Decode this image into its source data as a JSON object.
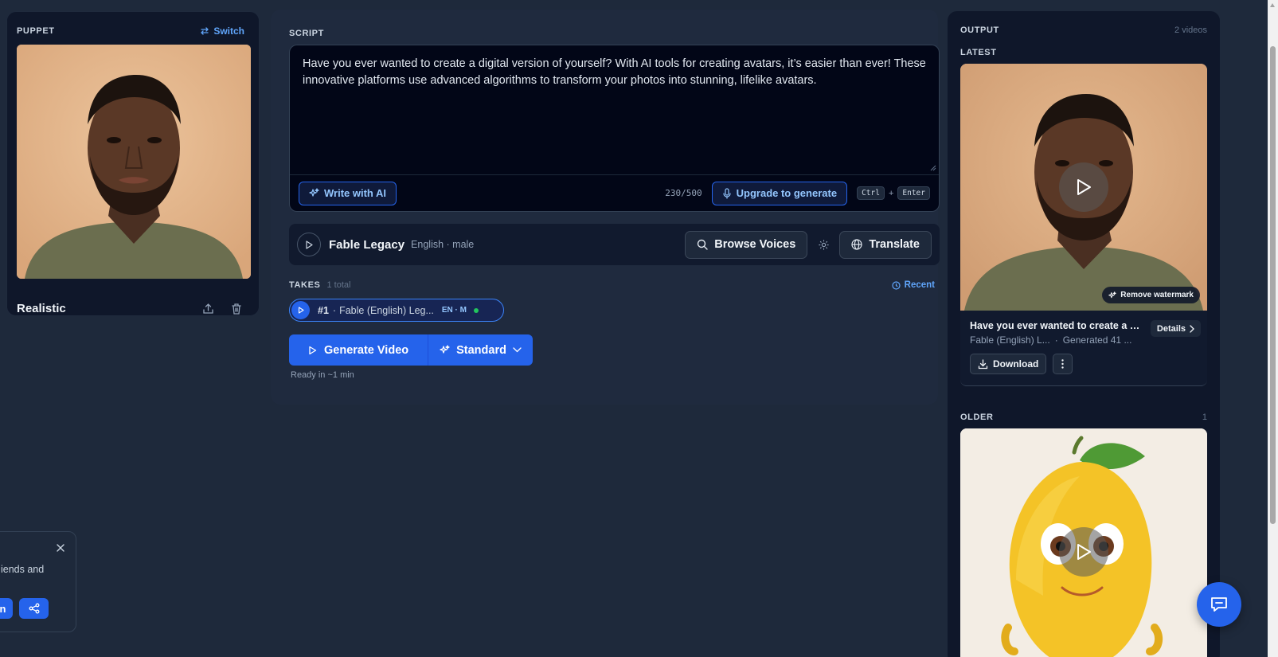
{
  "puppet": {
    "label": "PUPPET",
    "switch_label": "Switch",
    "name": "Realistic",
    "image_icon": "realistic-man-portrait"
  },
  "script": {
    "label": "SCRIPT",
    "text": "Have you ever wanted to create a digital version of yourself? With AI tools for creating avatars, it’s easier than ever! These innovative platforms use advanced algorithms to transform your photos into stunning, lifelike avatars.",
    "write_ai_label": "Write with AI",
    "char_count": "230/500",
    "upgrade_label": "Upgrade to generate",
    "shortcut_ctrl": "Ctrl",
    "shortcut_plus": "+",
    "shortcut_enter": "Enter"
  },
  "voice": {
    "name": "Fable Legacy",
    "meta": "English · male",
    "browse_label": "Browse Voices",
    "translate_label": "Translate"
  },
  "takes": {
    "label": "TAKES",
    "count": "1 total",
    "recent_label": "Recent",
    "items": [
      {
        "num": "#1",
        "sep": "·",
        "title": "Fable (English) Leg...",
        "lang": "EN · M"
      }
    ]
  },
  "generate": {
    "button_label": "Generate Video",
    "quality_label": "Standard",
    "eta": "Ready in ~1 min"
  },
  "output": {
    "label": "OUTPUT",
    "count": "2 videos",
    "latest_label": "LATEST",
    "latest": {
      "title": "Have you ever wanted to create a di...",
      "voice": "Fable (English) L...",
      "sep": "·",
      "generated": "Generated 41 ...",
      "details_label": "Details",
      "download_label": "Download",
      "remove_watermark_label": "Remove watermark"
    },
    "older_label": "OLDER",
    "older_count": "1"
  },
  "share_popup": {
    "text": "iends and",
    "button_a": "n"
  },
  "colors": {
    "accent": "#2563eb",
    "background": "#1e293b",
    "panel": "#0f172a",
    "link": "#60a5fa"
  }
}
